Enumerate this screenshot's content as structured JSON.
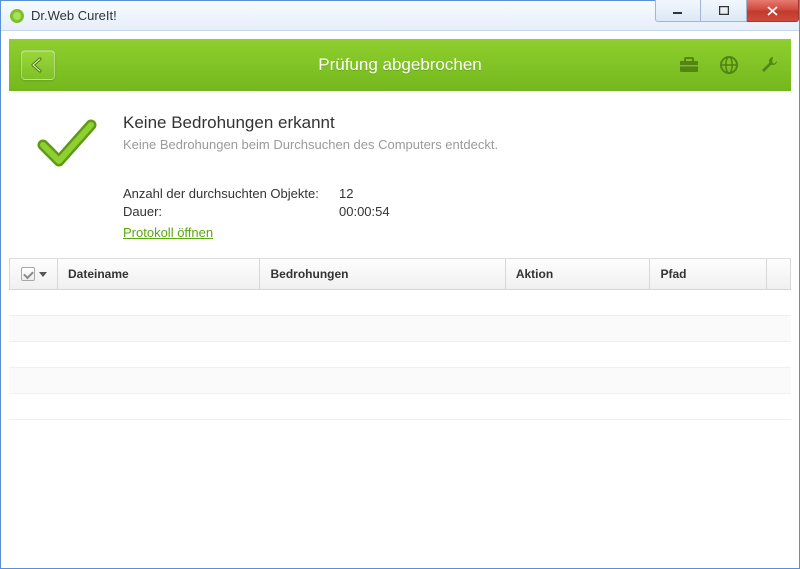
{
  "window": {
    "title": "Dr.Web CureIt!"
  },
  "toolbar": {
    "title": "Prüfung abgebrochen"
  },
  "summary": {
    "heading": "Keine Bedrohungen erkannt",
    "subheading": "Keine Bedrohungen beim Durchsuchen des Computers entdeckt.",
    "scanned_label": "Anzahl der durchsuchten Objekte:",
    "scanned_value": "12",
    "duration_label": "Dauer:",
    "duration_value": "00:00:54",
    "protocol_link": "Protokoll öffnen"
  },
  "table": {
    "headers": {
      "filename": "Dateiname",
      "threats": "Bedrohungen",
      "action": "Aktion",
      "path": "Pfad"
    }
  }
}
